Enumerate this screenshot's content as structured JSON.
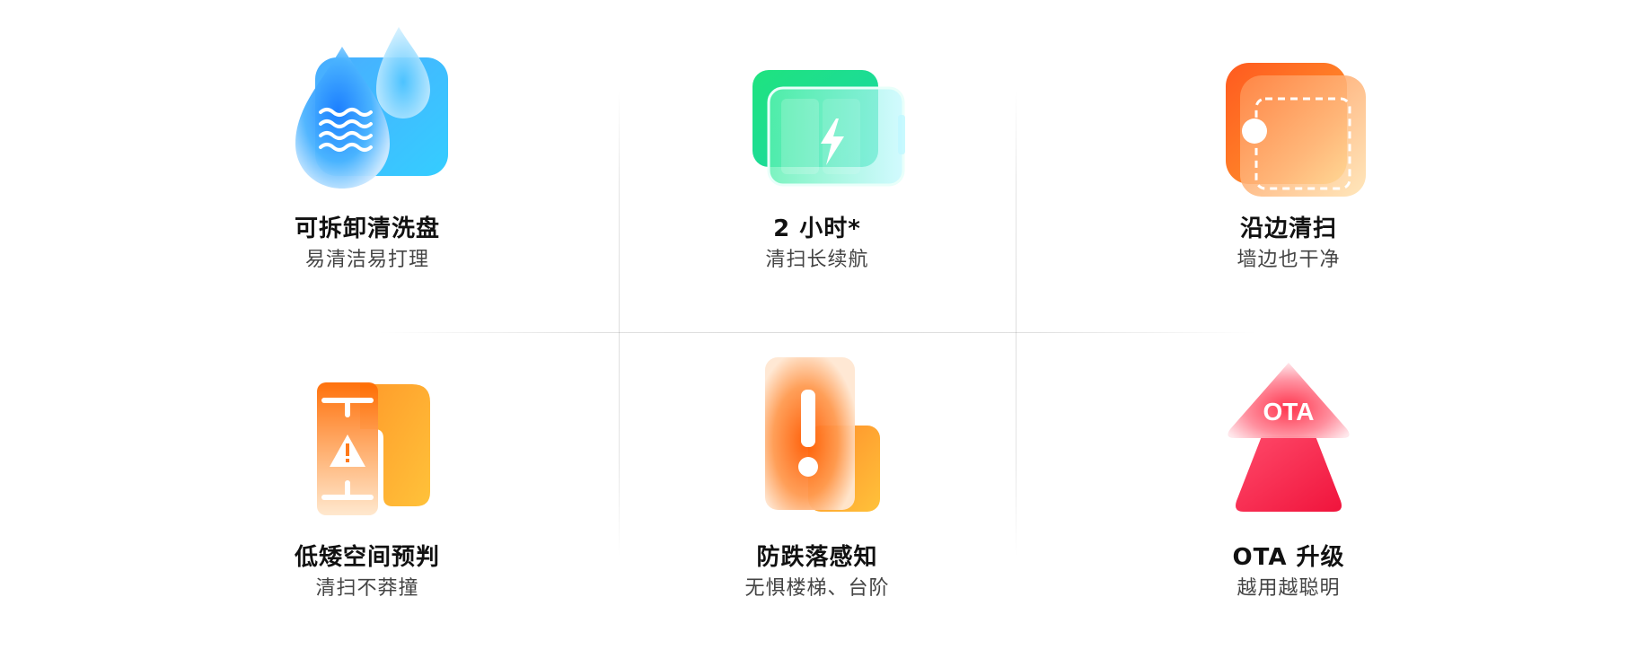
{
  "features": [
    {
      "title": "可拆卸清洗盘",
      "subtitle": "易清洁易打理",
      "icon": "water-drop-tray-icon"
    },
    {
      "title": "2 小时*",
      "subtitle": "清扫长续航",
      "icon": "battery-charging-icon"
    },
    {
      "title": "沿边清扫",
      "subtitle": "墙边也干净",
      "icon": "edge-cleaning-icon"
    },
    {
      "title": "低矮空间预判",
      "subtitle": "清扫不莽撞",
      "icon": "low-space-warning-icon"
    },
    {
      "title": "防跌落感知",
      "subtitle": "无惧楼梯、台阶",
      "icon": "fall-prevention-icon"
    },
    {
      "title": "OTA 升级",
      "subtitle": "越用越聪明",
      "icon": "ota-upgrade-icon"
    }
  ],
  "ota_icon_text": "OTA",
  "colors": {
    "blue": "#1e90ff",
    "green": "#1ee08a",
    "orange": "#ff7a1a",
    "red": "#f0284a"
  }
}
